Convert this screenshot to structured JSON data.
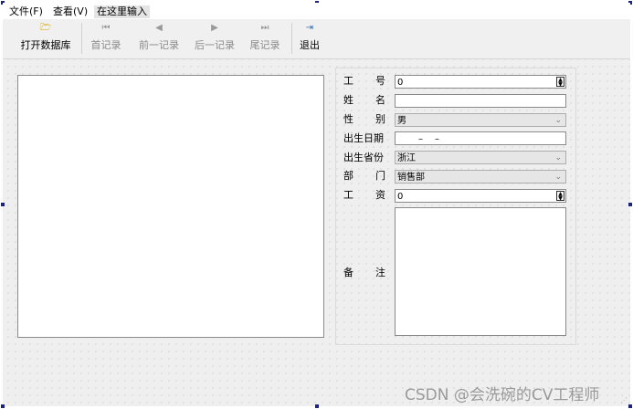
{
  "menu": {
    "file": "文件(F)",
    "view": "查看(V)",
    "new_item_placeholder": "在这里输入"
  },
  "toolbar": {
    "open": {
      "label": "打开数据库",
      "icon": "folder-open-icon"
    },
    "first": {
      "label": "首记录",
      "icon": "skip-first-icon"
    },
    "prev": {
      "label": "前一记录",
      "icon": "previous-icon"
    },
    "next": {
      "label": "后一记录",
      "icon": "next-icon"
    },
    "last": {
      "label": "尾记录",
      "icon": "skip-last-icon"
    },
    "exit": {
      "label": "退出",
      "icon": "exit-icon"
    }
  },
  "form": {
    "emp_no": {
      "label": [
        "工",
        "号"
      ],
      "value": "0"
    },
    "name": {
      "label": [
        "姓",
        "名"
      ],
      "value": ""
    },
    "gender": {
      "label": [
        "性",
        "别"
      ],
      "value": "男"
    },
    "birth_date": {
      "label": "出生日期",
      "separator": "–"
    },
    "province": {
      "label": "出生省份",
      "value": "浙江"
    },
    "department": {
      "label": [
        "部",
        "门"
      ],
      "value": "销售部"
    },
    "salary": {
      "label": [
        "工",
        "资"
      ],
      "value": "0"
    },
    "notes": {
      "label": [
        "备",
        "注"
      ],
      "value": ""
    }
  },
  "watermark": "CSDN @会洗碗的CV工程师",
  "colors": {
    "selection_handle": "#1a237e",
    "canvas": "#efefef"
  }
}
